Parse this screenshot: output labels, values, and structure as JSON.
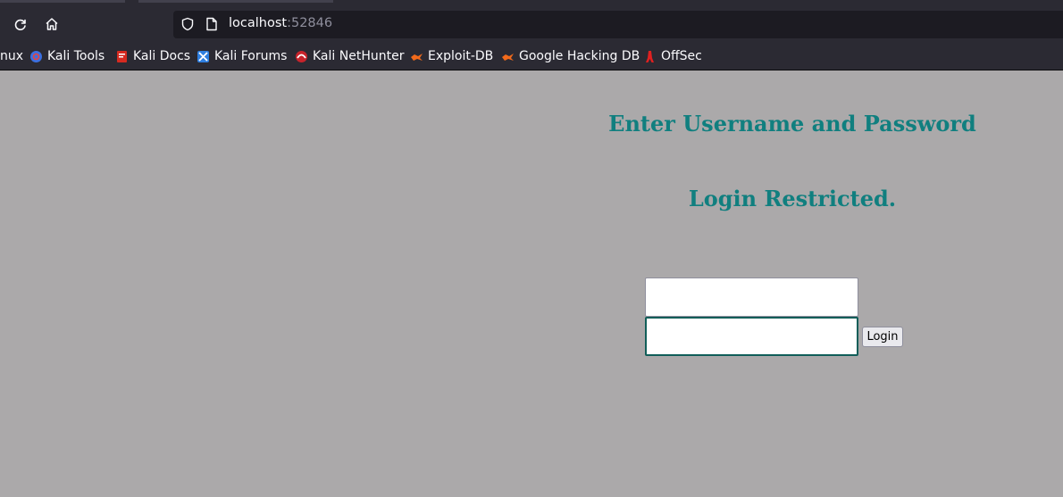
{
  "browser": {
    "url_host": "localhost",
    "url_port": ":52846",
    "bookmarks": [
      {
        "label": "nux",
        "icon": "kali-linux-icon"
      },
      {
        "label": "Kali Tools",
        "icon": "kali-tools-icon"
      },
      {
        "label": "Kali Docs",
        "icon": "kali-docs-icon"
      },
      {
        "label": "Kali Forums",
        "icon": "kali-forums-icon"
      },
      {
        "label": "Kali NetHunter",
        "icon": "kali-nethunter-icon"
      },
      {
        "label": "Exploit-DB",
        "icon": "exploit-db-icon"
      },
      {
        "label": "Google Hacking DB",
        "icon": "exploit-db-icon"
      },
      {
        "label": "OffSec",
        "icon": "offsec-icon"
      }
    ]
  },
  "page": {
    "heading": "Enter Username and Password",
    "subheading": "Login Restricted.",
    "username_value": "",
    "password_value": "",
    "login_label": "Login"
  },
  "colors": {
    "page_bg": "#aba9aa",
    "heading": "#107f7f",
    "chrome_bg": "#2b2a33"
  }
}
